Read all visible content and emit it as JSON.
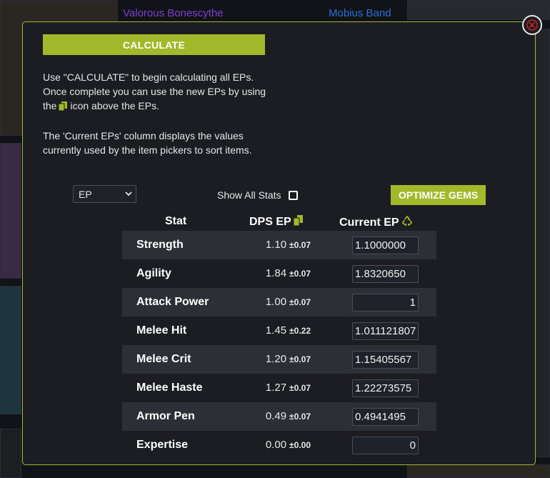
{
  "background": {
    "item_left": "Valorous Bonescythe",
    "item_right": "Mobius Band"
  },
  "modal": {
    "calculate_label": "CALCULATE",
    "info_p1_a": "Use \"CALCULATE\" to begin calculating all EPs. Once complete you can use the new EPs by using the",
    "info_p1_b": "icon above the EPs.",
    "info_p2": "The 'Current EPs' column displays the values currently used by the item pickers to sort items.",
    "ep_select_value": "EP",
    "show_all_label": "Show All Stats",
    "optimize_label": "OPTIMIZE GEMS",
    "close_icon": "close-icon"
  },
  "table": {
    "headers": {
      "stat": "Stat",
      "dps": "DPS EP",
      "current": "Current EP"
    },
    "rows": [
      {
        "stat": "Strength",
        "dps": "1.10",
        "err": "±0.07",
        "current": "1.1000000"
      },
      {
        "stat": "Agility",
        "dps": "1.84",
        "err": "±0.07",
        "current": "1.8320650"
      },
      {
        "stat": "Attack Power",
        "dps": "1.00",
        "err": "±0.07",
        "current": "1"
      },
      {
        "stat": "Melee Hit",
        "dps": "1.45",
        "err": "±0.22",
        "current": "1.011121807"
      },
      {
        "stat": "Melee Crit",
        "dps": "1.20",
        "err": "±0.07",
        "current": "1.15405567"
      },
      {
        "stat": "Melee Haste",
        "dps": "1.27",
        "err": "±0.07",
        "current": "1.22273575"
      },
      {
        "stat": "Armor Pen",
        "dps": "0.49",
        "err": "±0.07",
        "current": "0.4941495"
      },
      {
        "stat": "Expertise",
        "dps": "0.00",
        "err": "±0.00",
        "current": "0"
      }
    ]
  },
  "colors": {
    "accent": "#a3b92c",
    "modal_bg": "#1b1d22",
    "row_shade": "#2c2f36",
    "close_red": "#cc2222"
  }
}
